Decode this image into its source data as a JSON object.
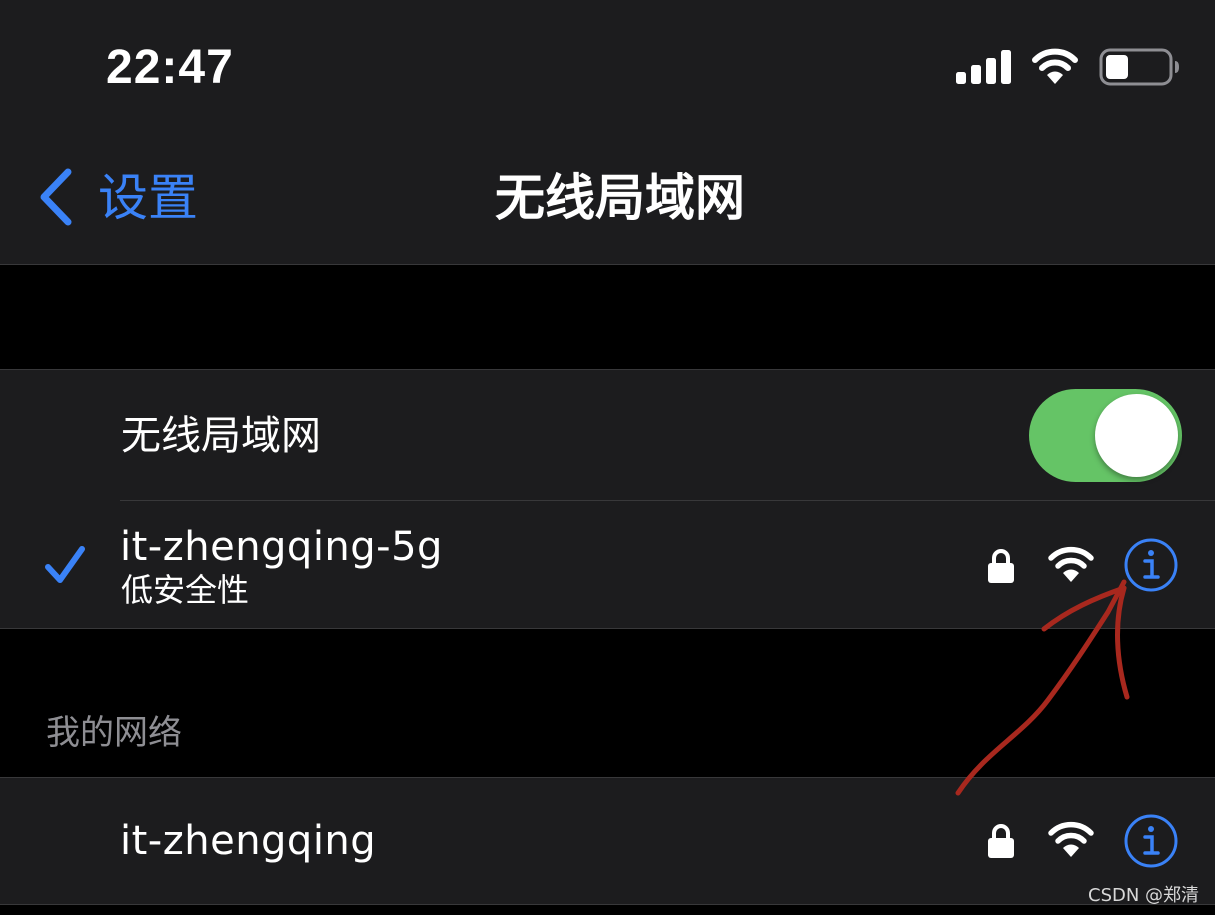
{
  "status_bar": {
    "time": "22:47",
    "signal_icon": "cellular-signal-icon",
    "wifi_icon": "wifi-icon",
    "battery_icon": "battery-icon",
    "battery_level": 0.3
  },
  "nav": {
    "back_label": "设置",
    "title": "无线局域网"
  },
  "wifi_toggle": {
    "label": "无线局域网",
    "on": true
  },
  "connected_network": {
    "name": "it-zhengqing-5g",
    "security_note": "低安全性",
    "connected": true
  },
  "my_networks": {
    "header": "我的网络",
    "items": [
      {
        "name": "it-zhengqing"
      }
    ]
  },
  "watermark": "CSDN @郑清",
  "colors": {
    "accent": "#3a82f7",
    "toggle_on": "#65c466",
    "group_bg": "#1c1c1e",
    "page_bg": "#000000",
    "annotation": "#a8281e"
  }
}
